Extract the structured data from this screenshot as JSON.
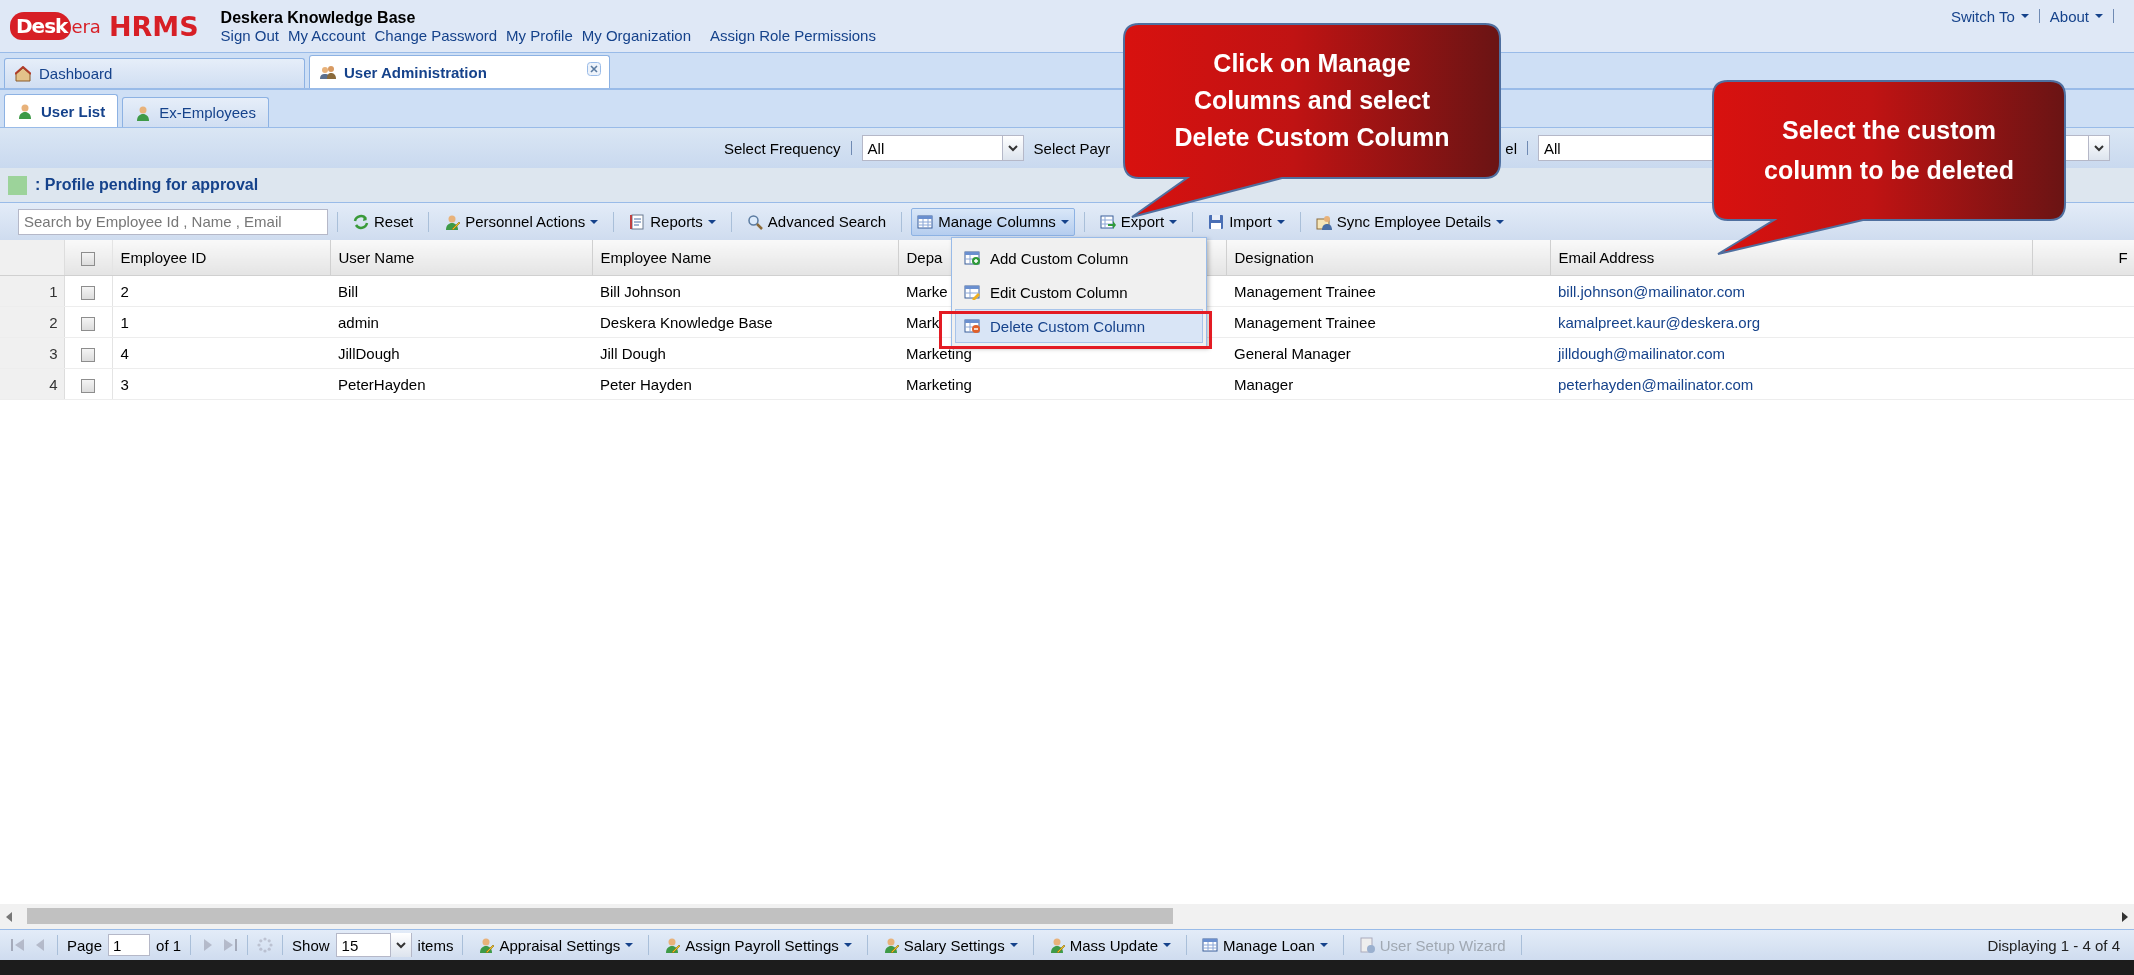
{
  "header": {
    "logo": [
      "Desk",
      "era"
    ],
    "product": "HRMS",
    "company": "Deskera Knowledge Base",
    "links": [
      "Sign Out",
      "My Account",
      "Change Password",
      "My Profile",
      "My Organization",
      "Assign Role Permissions"
    ],
    "right_menu": [
      "Switch To",
      "About"
    ]
  },
  "tabs": [
    {
      "label": "Dashboard",
      "kind": "house",
      "selected": false,
      "closable": false
    },
    {
      "label": "User Administration",
      "kind": "people",
      "selected": true,
      "closable": true
    }
  ],
  "subtabs": [
    {
      "label": "User List",
      "kind": "person",
      "selected": true
    },
    {
      "label": "Ex-Employees",
      "kind": "person",
      "selected": false
    }
  ],
  "filters": {
    "frequency_label": "Select Frequency",
    "frequency_value": "All",
    "payroll_label_start": "Select Payr",
    "payroll_label_end": "el",
    "payroll_value": "All"
  },
  "legend": ": Profile pending for approval",
  "toolbar": {
    "search_placeholder": "Search by Employee Id , Name , Email",
    "buttons": [
      {
        "label": "Reset",
        "kind": "refresh",
        "menu": false,
        "pressed": false
      },
      {
        "label": "Personnel Actions",
        "kind": "person-pencil",
        "menu": true,
        "pressed": false
      },
      {
        "label": "Reports",
        "kind": "report",
        "menu": true,
        "pressed": false
      },
      {
        "label": "Advanced Search",
        "kind": "search",
        "menu": false,
        "pressed": false
      },
      {
        "label": "Manage Columns",
        "kind": "table",
        "menu": true,
        "pressed": true
      },
      {
        "label": "Export",
        "kind": "export",
        "menu": true,
        "pressed": false
      },
      {
        "label": "Import",
        "kind": "import",
        "menu": true,
        "pressed": false
      },
      {
        "label": "Sync Employee Details",
        "kind": "sync",
        "menu": true,
        "pressed": false
      }
    ]
  },
  "menu": [
    {
      "label": "Add Custom Column",
      "kind": "add",
      "selected": false,
      "outlined": false
    },
    {
      "label": "Edit Custom Column",
      "kind": "edit",
      "selected": false,
      "outlined": false
    },
    {
      "label": "Delete Custom Column",
      "kind": "delete",
      "selected": true,
      "outlined": true
    }
  ],
  "grid": {
    "header_checked": false,
    "columns": [
      "Employee ID",
      "User Name",
      "Employee Name",
      "Depa",
      "Designation",
      "Email Address",
      "F"
    ],
    "rows": [
      {
        "number": "1",
        "checked": false,
        "cells": [
          "2",
          "Bill",
          "Bill Johnson",
          "Marke",
          "Management Trainee",
          "bill.johnson@mailinator.com"
        ]
      },
      {
        "number": "2",
        "checked": false,
        "cells": [
          "1",
          "admin",
          "Deskera Knowledge Base",
          "Mark",
          "Management Trainee",
          "kamalpreet.kaur@deskera.org"
        ]
      },
      {
        "number": "3",
        "checked": false,
        "cells": [
          "4",
          "JillDough",
          "Jill Dough",
          "Marketing",
          "General Manager",
          "jilldough@mailinator.com"
        ]
      },
      {
        "number": "4",
        "checked": false,
        "cells": [
          "3",
          "PeterHayden",
          "Peter Hayden",
          "Marketing",
          "Manager",
          "peterhayden@mailinator.com"
        ]
      }
    ]
  },
  "pager": {
    "nav_disabled": true,
    "page_label": "Page",
    "page": "1",
    "of_label": "of 1",
    "show_label": "Show",
    "page_size": "15",
    "items_label": "items"
  },
  "bottom_buttons": [
    {
      "label": "Appraisal Settings",
      "kind": "person-pencil",
      "menu": true,
      "disabled": false
    },
    {
      "label": "Assign Payroll Settings",
      "kind": "person-pencil",
      "menu": true,
      "disabled": false
    },
    {
      "label": "Salary Settings",
      "kind": "person-pencil",
      "menu": true,
      "disabled": false
    },
    {
      "label": "Mass Update",
      "kind": "person-pencil",
      "menu": true,
      "disabled": false
    },
    {
      "label": "Manage Loan",
      "kind": "grid",
      "menu": true,
      "disabled": false
    },
    {
      "label": "User Setup Wizard",
      "kind": "wizard",
      "menu": false,
      "disabled": true
    }
  ],
  "status": "Displaying 1 - 4 of 4",
  "callouts": [
    "Click on Manage\nColumns and select\nDelete Custom Column",
    "Select the custom\ncolumn to be deleted"
  ]
}
